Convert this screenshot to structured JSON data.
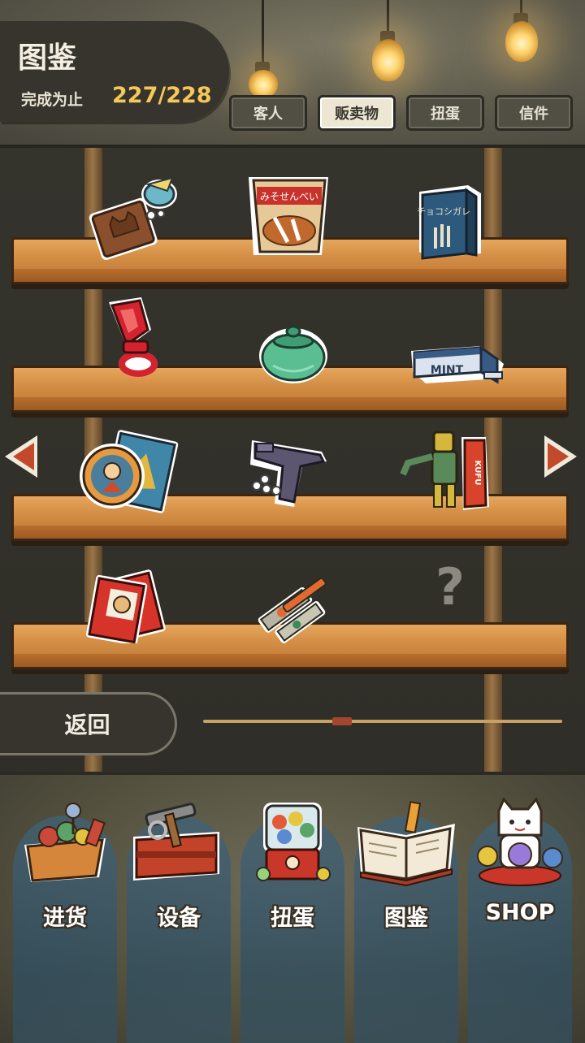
{
  "header": {
    "title": "图鉴",
    "progress_label": "完成为止",
    "progress_count": "227/228"
  },
  "tabs": [
    {
      "label": "客人",
      "active": false
    },
    {
      "label": "贩卖物",
      "active": true
    },
    {
      "label": "扭蛋",
      "active": false
    },
    {
      "label": "信件",
      "active": false
    }
  ],
  "shelves": {
    "items": [
      {
        "name": "chocolate-cat-icon"
      },
      {
        "name": "rice-cracker-bag-icon",
        "text": "みそせんべい"
      },
      {
        "name": "choco-cigarette-box-icon",
        "text": "チョコシガレ"
      },
      {
        "name": "ring-candy-icon"
      },
      {
        "name": "green-jar-icon"
      },
      {
        "name": "mint-gum-icon",
        "text": "MINT"
      },
      {
        "name": "hero-card-icon"
      },
      {
        "name": "toy-pistol-icon"
      },
      {
        "name": "robot-figure-box-icon",
        "text": "KUFU"
      },
      {
        "name": "card-pack-icon"
      },
      {
        "name": "paint-tubes-icon"
      },
      {
        "name": "unknown-item-icon",
        "text": "?"
      }
    ],
    "prev_arrow": "chevron-left-icon",
    "next_arrow": "chevron-right-icon"
  },
  "footer": {
    "back_label": "返回",
    "page_position": 0.38
  },
  "nav": [
    {
      "label": "进货",
      "icon": "stock-basket-icon"
    },
    {
      "label": "设备",
      "icon": "toolbox-icon"
    },
    {
      "label": "扭蛋",
      "icon": "gacha-machine-icon"
    },
    {
      "label": "图鉴",
      "icon": "book-icon"
    },
    {
      "label": "SHOP",
      "icon": "lucky-cat-icon"
    }
  ],
  "colors": {
    "accent_count": "#f5c85a",
    "shelf_wood": "#d48e45",
    "arrow_red": "#c24a2a"
  }
}
